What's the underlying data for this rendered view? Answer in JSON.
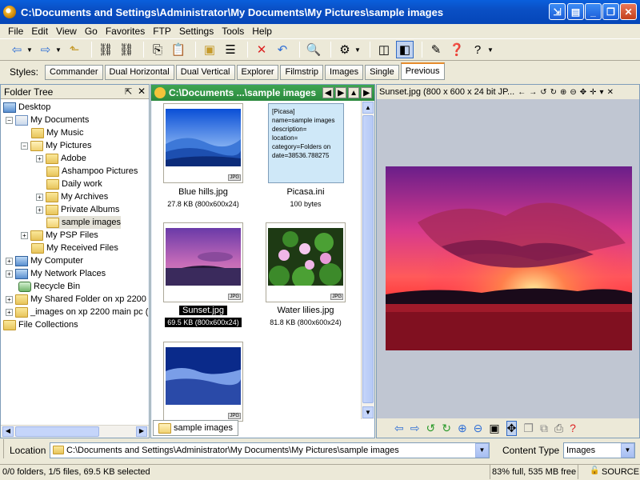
{
  "window": {
    "title": "C:\\Documents and Settings\\Administrator\\My Documents\\My Pictures\\sample images"
  },
  "menu": [
    "File",
    "Edit",
    "View",
    "Go",
    "Favorites",
    "FTP",
    "Settings",
    "Tools",
    "Help"
  ],
  "styles": {
    "label": "Styles:",
    "tabs": [
      "Commander",
      "Dual Horizontal",
      "Dual Vertical",
      "Explorer",
      "Filmstrip",
      "Images",
      "Single",
      "Previous"
    ],
    "active": "Previous"
  },
  "tree": {
    "title": "Folder Tree",
    "items": [
      "Desktop",
      "My Documents",
      "My Music",
      "My Pictures",
      "Adobe",
      "Ashampoo Pictures",
      "Daily work",
      "My Archives",
      "Private Albums",
      "sample images",
      "My PSP Files",
      "My Received Files",
      "My Computer",
      "My Network Places",
      "Recycle Bin",
      "My Shared Folder on xp 2200",
      "_images on xp 2200 main pc (",
      "File Collections"
    ]
  },
  "files": {
    "header": "C:\\Documents ...\\sample images",
    "items": [
      {
        "name": "Blue hills.jpg",
        "info": "27.8 KB (800x600x24)",
        "badge": "JPG"
      },
      {
        "name": "Picasa.ini",
        "info": "100 bytes",
        "text": "[Picasa]\nname=sample images\ndescription=\nlocation=\ncategory=Folders on\ndate=38536.788275"
      },
      {
        "name": "Sunset.jpg",
        "info": "69.5 KB (800x600x24)",
        "badge": "JPG"
      },
      {
        "name": "Water lilies.jpg",
        "info": "81.8 KB (800x600x24)",
        "badge": "JPG"
      },
      {
        "name": "",
        "info": "",
        "badge": "JPG"
      }
    ],
    "folder_tab": "sample images"
  },
  "preview": {
    "header": "Sunset.jpg (800 x 600 x 24 bit JP..."
  },
  "location": {
    "label": "Location",
    "path": "C:\\Documents and Settings\\Administrator\\My Documents\\My Pictures\\sample images"
  },
  "content_type": {
    "label": "Content Type",
    "value": "Images"
  },
  "status": {
    "left": "0/0 folders, 1/5 files, 69.5 KB selected",
    "free": "83% full, 535 MB free",
    "source": "SOURCE"
  },
  "colors": {
    "title_bar": "#0a4fc4",
    "file_header": "#2b8a3e",
    "selection": "#000000"
  }
}
